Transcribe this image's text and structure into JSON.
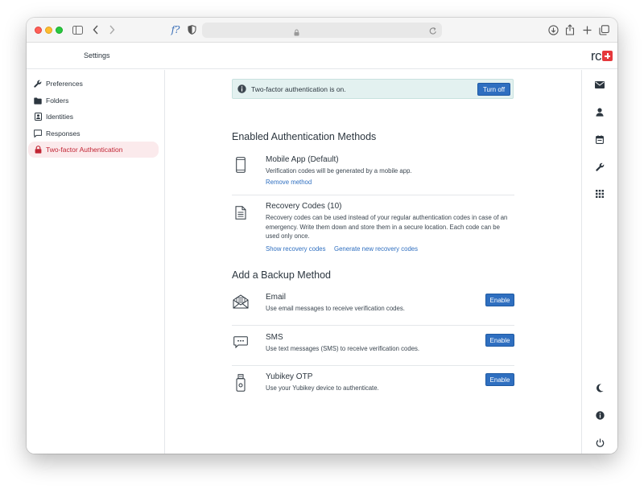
{
  "browser": {
    "func_glyph": "f?"
  },
  "header": {
    "title": "Settings",
    "logo_text": "rc"
  },
  "sidebar": {
    "items": [
      {
        "label": "Preferences",
        "icon": "wrench-icon"
      },
      {
        "label": "Folders",
        "icon": "folder-icon"
      },
      {
        "label": "Identities",
        "icon": "id-card-icon"
      },
      {
        "label": "Responses",
        "icon": "comment-icon"
      },
      {
        "label": "Two-factor Authentication",
        "icon": "lock-icon",
        "active": true
      }
    ]
  },
  "notice": {
    "text": "Two-factor authentication is on.",
    "button": "Turn off"
  },
  "enabled": {
    "heading": "Enabled Authentication Methods",
    "methods": [
      {
        "title": "Mobile App (Default)",
        "description": "Verification codes will be generated by a mobile app.",
        "links": [
          "Remove method"
        ],
        "icon": "mobile-phone-icon"
      },
      {
        "title": "Recovery Codes (10)",
        "description": "Recovery codes can be used instead of your regular authentication codes in case of an emergency. Write them down and store them in a secure location. Each code can be used only once.",
        "links": [
          "Show recovery codes",
          "Generate new recovery codes"
        ],
        "icon": "document-icon"
      }
    ]
  },
  "backup": {
    "heading": "Add a Backup Method",
    "methods": [
      {
        "title": "Email",
        "description": "Use email messages to receive verification codes.",
        "button": "Enable",
        "icon": "envelope-open-icon"
      },
      {
        "title": "SMS",
        "description": "Use text messages (SMS) to receive verification codes.",
        "button": "Enable",
        "icon": "sms-message-icon"
      },
      {
        "title": "Yubikey OTP",
        "description": "Use your Yubikey device to authenticate.",
        "button": "Enable",
        "icon": "usb-key-icon"
      }
    ]
  },
  "colors": {
    "accent": "#2f6fc0",
    "active_item_bg": "#fbeaec",
    "active_item_text": "#c22534",
    "notice_bg": "#e3f1f0",
    "logo_red": "#e5383c"
  }
}
